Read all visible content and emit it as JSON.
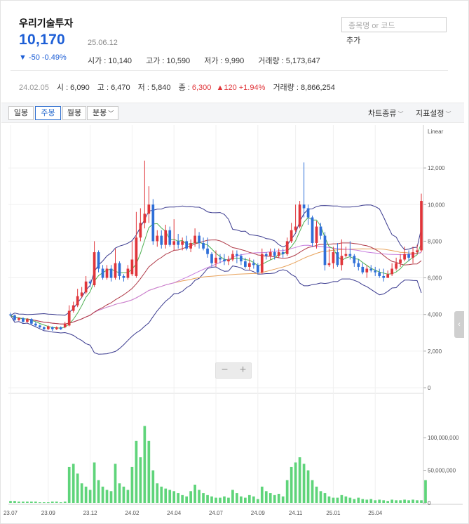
{
  "header": {
    "stock_name": "우리기술투자",
    "price": "10,170",
    "change": "▼ -50 -0.49%",
    "date": "25.06.12",
    "ohlc": {
      "open": "시가 : 10,140",
      "high": "고가 : 10,590",
      "low": "저가 : 9,990",
      "volume": "거래량 : 5,173,647"
    },
    "search_placeholder": "종목명 or 코드",
    "add_label": "추가"
  },
  "hover": {
    "date": "24.02.05",
    "open": "시 : 6,090",
    "high": "고 : 6,470",
    "low": "저 : 5,840",
    "close_label": "종 : ",
    "close": "6,300",
    "change": "▲120 +1.94%",
    "volume": "거래량 : 8,866,254"
  },
  "toolbar": {
    "tabs": [
      "일봉",
      "주봉",
      "월봉",
      "분봉"
    ],
    "active_tab": "주봉",
    "chart_type": "차트종류",
    "indicator": "지표설정"
  },
  "zoom": {
    "minus": "−",
    "plus": "+"
  },
  "side_toggle": "‹",
  "colors": {
    "up": "#e0353a",
    "down": "#2f6fd8",
    "volume": "#5fd47a",
    "bollinger": "#3b3b8f",
    "ma_short": "#4caf50",
    "ma_mid": "#b03a48",
    "ma_long": "#c77dde",
    "ma_longest": "#e8a25a"
  },
  "chart_data": {
    "type": "candlestick",
    "scale_label": "Linear",
    "price_ticks": [
      "12,000",
      "10,000",
      "8,000",
      "6,000",
      "4,000",
      "2,000",
      "0"
    ],
    "price_tick_values": [
      12000,
      10000,
      8000,
      6000,
      4000,
      2000,
      0
    ],
    "volume_ticks": [
      "100,000,000",
      "50,000,000",
      "0"
    ],
    "volume_tick_values": [
      100000000,
      50000000,
      0
    ],
    "x_ticks": [
      "23.07",
      "23.09",
      "23.12",
      "24.02",
      "24.04",
      "24.07",
      "24.09",
      "24.11",
      "25.01",
      "25.04"
    ],
    "x_tick_index": [
      0,
      9,
      19,
      29,
      39,
      49,
      59,
      68,
      77,
      87
    ],
    "ylim": [
      0,
      13500
    ],
    "vlim": [
      0,
      140000000
    ],
    "candles": [
      [
        4000,
        3950,
        4100,
        3900
      ],
      [
        3950,
        3700,
        4000,
        3650
      ],
      [
        3700,
        3800,
        3850,
        3650
      ],
      [
        3800,
        3600,
        3850,
        3550
      ],
      [
        3600,
        3750,
        3800,
        3550
      ],
      [
        3750,
        3500,
        3800,
        3450
      ],
      [
        3500,
        3400,
        3600,
        3350
      ],
      [
        3400,
        3300,
        3450,
        3250
      ],
      [
        3300,
        3200,
        3350,
        3150
      ],
      [
        3200,
        3350,
        3400,
        3150
      ],
      [
        3300,
        3200,
        3350,
        3100
      ],
      [
        3200,
        3300,
        3350,
        3150
      ],
      [
        3300,
        3200,
        3350,
        3150
      ],
      [
        3300,
        3500,
        3600,
        3250
      ],
      [
        3400,
        4200,
        4500,
        3350
      ],
      [
        4200,
        4500,
        4700,
        4100
      ],
      [
        4500,
        5000,
        5400,
        4400
      ],
      [
        5000,
        5200,
        5500,
        4900
      ],
      [
        5200,
        5800,
        6100,
        5100
      ],
      [
        5800,
        5700,
        5900,
        5500
      ],
      [
        5600,
        7400,
        8000,
        5500
      ],
      [
        7400,
        6500,
        7500,
        6300
      ],
      [
        6500,
        6000,
        6700,
        5900
      ],
      [
        6000,
        6500,
        6700,
        5900
      ],
      [
        6500,
        6000,
        6700,
        5800
      ],
      [
        6000,
        6800,
        7600,
        5900
      ],
      [
        6800,
        6100,
        6900,
        5900
      ],
      [
        6100,
        6000,
        6200,
        5800
      ],
      [
        6000,
        6500,
        6700,
        5900
      ],
      [
        6200,
        7000,
        8000,
        6100
      ],
      [
        6100,
        8200,
        9600,
        6000
      ],
      [
        8200,
        9000,
        9800,
        8000
      ],
      [
        9000,
        9500,
        12400,
        8700
      ],
      [
        9500,
        10000,
        11000,
        9000
      ],
      [
        10000,
        8000,
        10300,
        7800
      ],
      [
        8000,
        8300,
        8600,
        7700
      ],
      [
        8300,
        7800,
        8600,
        7600
      ],
      [
        7800,
        8600,
        8900,
        7600
      ],
      [
        8600,
        7800,
        8800,
        7700
      ],
      [
        7800,
        8000,
        9200,
        7500
      ],
      [
        8000,
        7800,
        8400,
        7600
      ],
      [
        7800,
        8000,
        8200,
        7500
      ],
      [
        8000,
        7600,
        8300,
        7500
      ],
      [
        7600,
        7900,
        8100,
        7400
      ],
      [
        7900,
        8300,
        8700,
        7700
      ],
      [
        8300,
        7900,
        8500,
        7600
      ],
      [
        7900,
        7600,
        8200,
        7500
      ],
      [
        7600,
        7300,
        8200,
        7100
      ],
      [
        7300,
        6800,
        7400,
        6600
      ],
      [
        6800,
        7100,
        7500,
        6600
      ],
      [
        7100,
        7000,
        7300,
        6800
      ],
      [
        7000,
        6900,
        7300,
        6700
      ],
      [
        6900,
        7000,
        7200,
        6700
      ],
      [
        7000,
        7300,
        7500,
        6900
      ],
      [
        7300,
        7200,
        7500,
        6800
      ],
      [
        7200,
        6900,
        7300,
        6700
      ],
      [
        6900,
        6600,
        7100,
        6500
      ],
      [
        6600,
        6800,
        7100,
        6400
      ],
      [
        6800,
        6700,
        7000,
        6500
      ],
      [
        6700,
        6300,
        6800,
        6200
      ],
      [
        6300,
        7300,
        7600,
        6200
      ],
      [
        7300,
        7200,
        7400,
        7000
      ],
      [
        7200,
        7400,
        7600,
        7000
      ],
      [
        7400,
        7200,
        7600,
        7000
      ],
      [
        7200,
        7400,
        7600,
        7100
      ],
      [
        7400,
        7300,
        7600,
        7100
      ],
      [
        7300,
        8000,
        8200,
        7200
      ],
      [
        8000,
        8600,
        9000,
        7900
      ],
      [
        8600,
        8800,
        10000,
        8500
      ],
      [
        8800,
        10000,
        10200,
        8700
      ],
      [
        10000,
        9800,
        12300,
        9300
      ],
      [
        9800,
        9300,
        10000,
        8900
      ],
      [
        9300,
        7900,
        9400,
        7700
      ],
      [
        7900,
        8800,
        9100,
        7600
      ],
      [
        8800,
        8300,
        9000,
        8100
      ],
      [
        8300,
        6700,
        8500,
        6400
      ],
      [
        6700,
        6800,
        7600,
        6600
      ],
      [
        6800,
        7400,
        7700,
        6500
      ],
      [
        7400,
        6700,
        7900,
        6600
      ],
      [
        6700,
        7200,
        8100,
        6400
      ],
      [
        7200,
        7300,
        7700,
        7100
      ],
      [
        7300,
        7200,
        8000,
        7000
      ],
      [
        7200,
        6800,
        7300,
        6600
      ],
      [
        6800,
        6600,
        7000,
        6400
      ],
      [
        6600,
        6300,
        6800,
        6200
      ],
      [
        6300,
        6500,
        6700,
        6000
      ],
      [
        6500,
        6400,
        6700,
        6300
      ],
      [
        6400,
        6300,
        6600,
        6100
      ],
      [
        6300,
        6100,
        6500,
        6000
      ],
      [
        6100,
        6000,
        6500,
        5800
      ],
      [
        6000,
        6200,
        6400,
        6000
      ],
      [
        6200,
        6500,
        6800,
        6100
      ],
      [
        6500,
        6800,
        7100,
        6400
      ],
      [
        6800,
        7000,
        7300,
        6600
      ],
      [
        7000,
        7300,
        7700,
        6900
      ],
      [
        7300,
        7100,
        7500,
        6900
      ],
      [
        7100,
        7400,
        7700,
        6800
      ],
      [
        7400,
        7500,
        7800,
        7300
      ],
      [
        7500,
        10200,
        10600,
        7400
      ]
    ],
    "volumes": [
      3,
      3,
      2,
      2,
      2,
      2,
      2,
      1,
      1,
      1,
      2,
      2,
      1,
      2,
      55,
      60,
      45,
      30,
      25,
      20,
      62,
      35,
      25,
      20,
      18,
      60,
      30,
      25,
      20,
      55,
      95,
      70,
      118,
      95,
      50,
      30,
      25,
      22,
      20,
      18,
      15,
      12,
      10,
      18,
      28,
      20,
      15,
      12,
      10,
      8,
      8,
      10,
      8,
      20,
      15,
      10,
      8,
      12,
      10,
      6,
      25,
      18,
      15,
      12,
      14,
      10,
      35,
      55,
      62,
      70,
      60,
      50,
      35,
      25,
      18,
      15,
      10,
      8,
      8,
      12,
      10,
      8,
      6,
      8,
      6,
      5,
      6,
      4,
      5,
      4,
      3,
      5,
      4,
      4,
      5,
      4,
      5,
      4,
      4,
      35
    ]
  }
}
